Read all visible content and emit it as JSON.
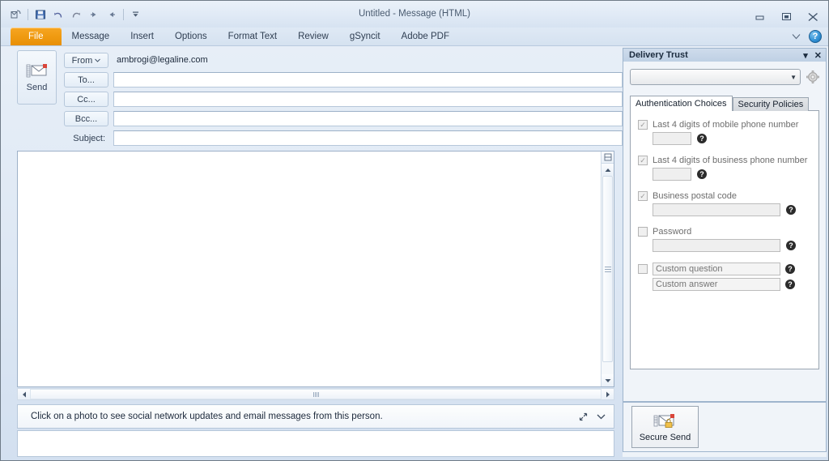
{
  "window": {
    "title": "Untitled  -  Message (HTML)",
    "controls": {
      "minimize": "minimize-button",
      "restore": "restore-button",
      "close": "close-button"
    }
  },
  "quick_access": {
    "items": [
      {
        "name": "outlook-icon",
        "label": "Outlook"
      },
      {
        "name": "save-icon",
        "label": "Save"
      },
      {
        "name": "undo-icon",
        "label": "Undo"
      },
      {
        "name": "redo-icon",
        "label": "Redo"
      },
      {
        "name": "previous-item-icon",
        "label": "Previous Item"
      },
      {
        "name": "next-item-icon",
        "label": "Next Item"
      },
      {
        "name": "customize-qat-icon",
        "label": "Customize Quick Access Toolbar"
      }
    ]
  },
  "ribbon": {
    "tabs": [
      {
        "label": "File",
        "active": true
      },
      {
        "label": "Message",
        "active": false
      },
      {
        "label": "Insert",
        "active": false
      },
      {
        "label": "Options",
        "active": false
      },
      {
        "label": "Format Text",
        "active": false
      },
      {
        "label": "Review",
        "active": false
      },
      {
        "label": "gSyncit",
        "active": false
      },
      {
        "label": "Adobe PDF",
        "active": false
      }
    ],
    "collapse_label": "^",
    "help_label": "?"
  },
  "compose": {
    "send_label": "Send",
    "fields": [
      {
        "type": "button-dropdown",
        "label": "From",
        "value": "ambrogi@legaline.com"
      },
      {
        "type": "button-input",
        "label": "To...",
        "value": ""
      },
      {
        "type": "button-input",
        "label": "Cc...",
        "value": ""
      },
      {
        "type": "button-input",
        "label": "Bcc...",
        "value": ""
      },
      {
        "type": "label-input",
        "label": "Subject:",
        "value": ""
      }
    ],
    "body_value": ""
  },
  "people_pane": {
    "text": "Click on a photo to see social network updates and email messages from this person.",
    "expand_label": "expand-icon",
    "collapse_label": "chevron-down-icon"
  },
  "delivery_trust": {
    "title": "Delivery Trust",
    "minimize_label": "▾",
    "close_label": "✕",
    "profile_select_value": "",
    "settings_label": "gear-icon",
    "tabs": [
      {
        "label": "Authentication Choices",
        "active": true
      },
      {
        "label": "Security Policies",
        "active": false
      }
    ],
    "auth_options": [
      {
        "label": "Last 4 digits of mobile phone number",
        "checked": true,
        "disabled": true,
        "field": {
          "size": "small",
          "value": ""
        },
        "help": "?"
      },
      {
        "label": "Last 4 digits of business phone number",
        "checked": true,
        "disabled": true,
        "field": {
          "size": "small",
          "value": ""
        },
        "help": "?"
      },
      {
        "label": "Business postal code",
        "checked": true,
        "disabled": true,
        "field": {
          "size": "wide",
          "value": ""
        },
        "help": "?"
      },
      {
        "label": "Password",
        "checked": false,
        "disabled": false,
        "field": {
          "size": "wide",
          "value": ""
        },
        "help": "?"
      }
    ],
    "custom": {
      "checked": false,
      "question_placeholder": "Custom question",
      "answer_placeholder": "Custom answer",
      "help": "?"
    },
    "secure_send_label": "Secure Send"
  }
}
